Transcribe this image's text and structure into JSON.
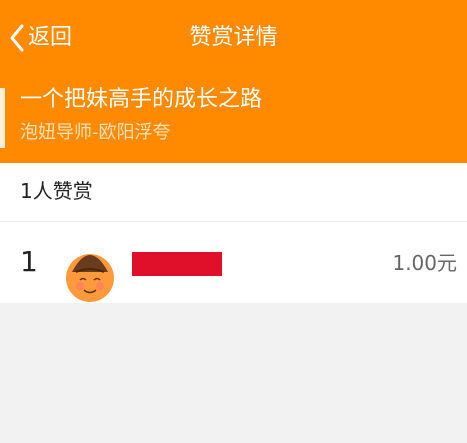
{
  "header": {
    "back_label": "返回",
    "title": "赞赏详情"
  },
  "article": {
    "title": "一个把妹高手的成长之路",
    "author": "泡妞导师-欧阳浮夸"
  },
  "rewards": {
    "count_label": "1人赞赏",
    "donors": [
      {
        "rank": "1",
        "name": "",
        "amount": "1.00元"
      }
    ]
  },
  "colors": {
    "accent": "#ff8a00",
    "redaction": "#e0102a",
    "background": "#f2f2f2"
  }
}
